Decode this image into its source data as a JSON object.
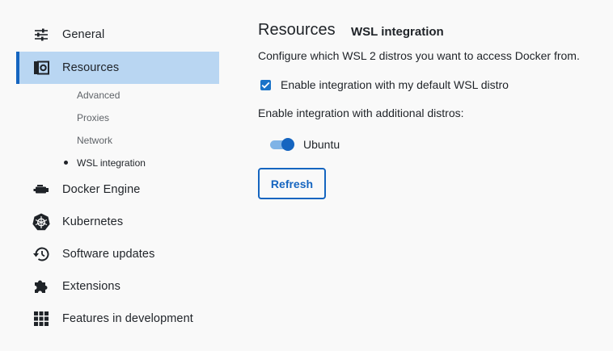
{
  "sidebar": {
    "items": [
      {
        "label": "General",
        "icon": "sliders-icon"
      },
      {
        "label": "Resources",
        "icon": "resources-icon"
      },
      {
        "label": "Docker Engine",
        "icon": "docker-engine-icon"
      },
      {
        "label": "Kubernetes",
        "icon": "kubernetes-icon"
      },
      {
        "label": "Software updates",
        "icon": "history-icon"
      },
      {
        "label": "Extensions",
        "icon": "puzzle-icon"
      },
      {
        "label": "Features in development",
        "icon": "grid-icon"
      }
    ],
    "subitems": [
      {
        "label": "Advanced"
      },
      {
        "label": "Proxies"
      },
      {
        "label": "Network"
      },
      {
        "label": "WSL integration"
      }
    ]
  },
  "main": {
    "title": "Resources",
    "subtitle": "WSL integration",
    "description": "Configure which WSL 2 distros you want to access Docker from.",
    "default_integration": {
      "label": "Enable integration with my default WSL distro",
      "checked": true
    },
    "additional_label": "Enable integration with additional distros:",
    "distros": [
      {
        "name": "Ubuntu",
        "enabled": true
      }
    ],
    "refresh_label": "Refresh"
  },
  "colors": {
    "accent": "#1565c0",
    "active_bg": "#b9d6f2",
    "background": "#f9f9f9"
  }
}
